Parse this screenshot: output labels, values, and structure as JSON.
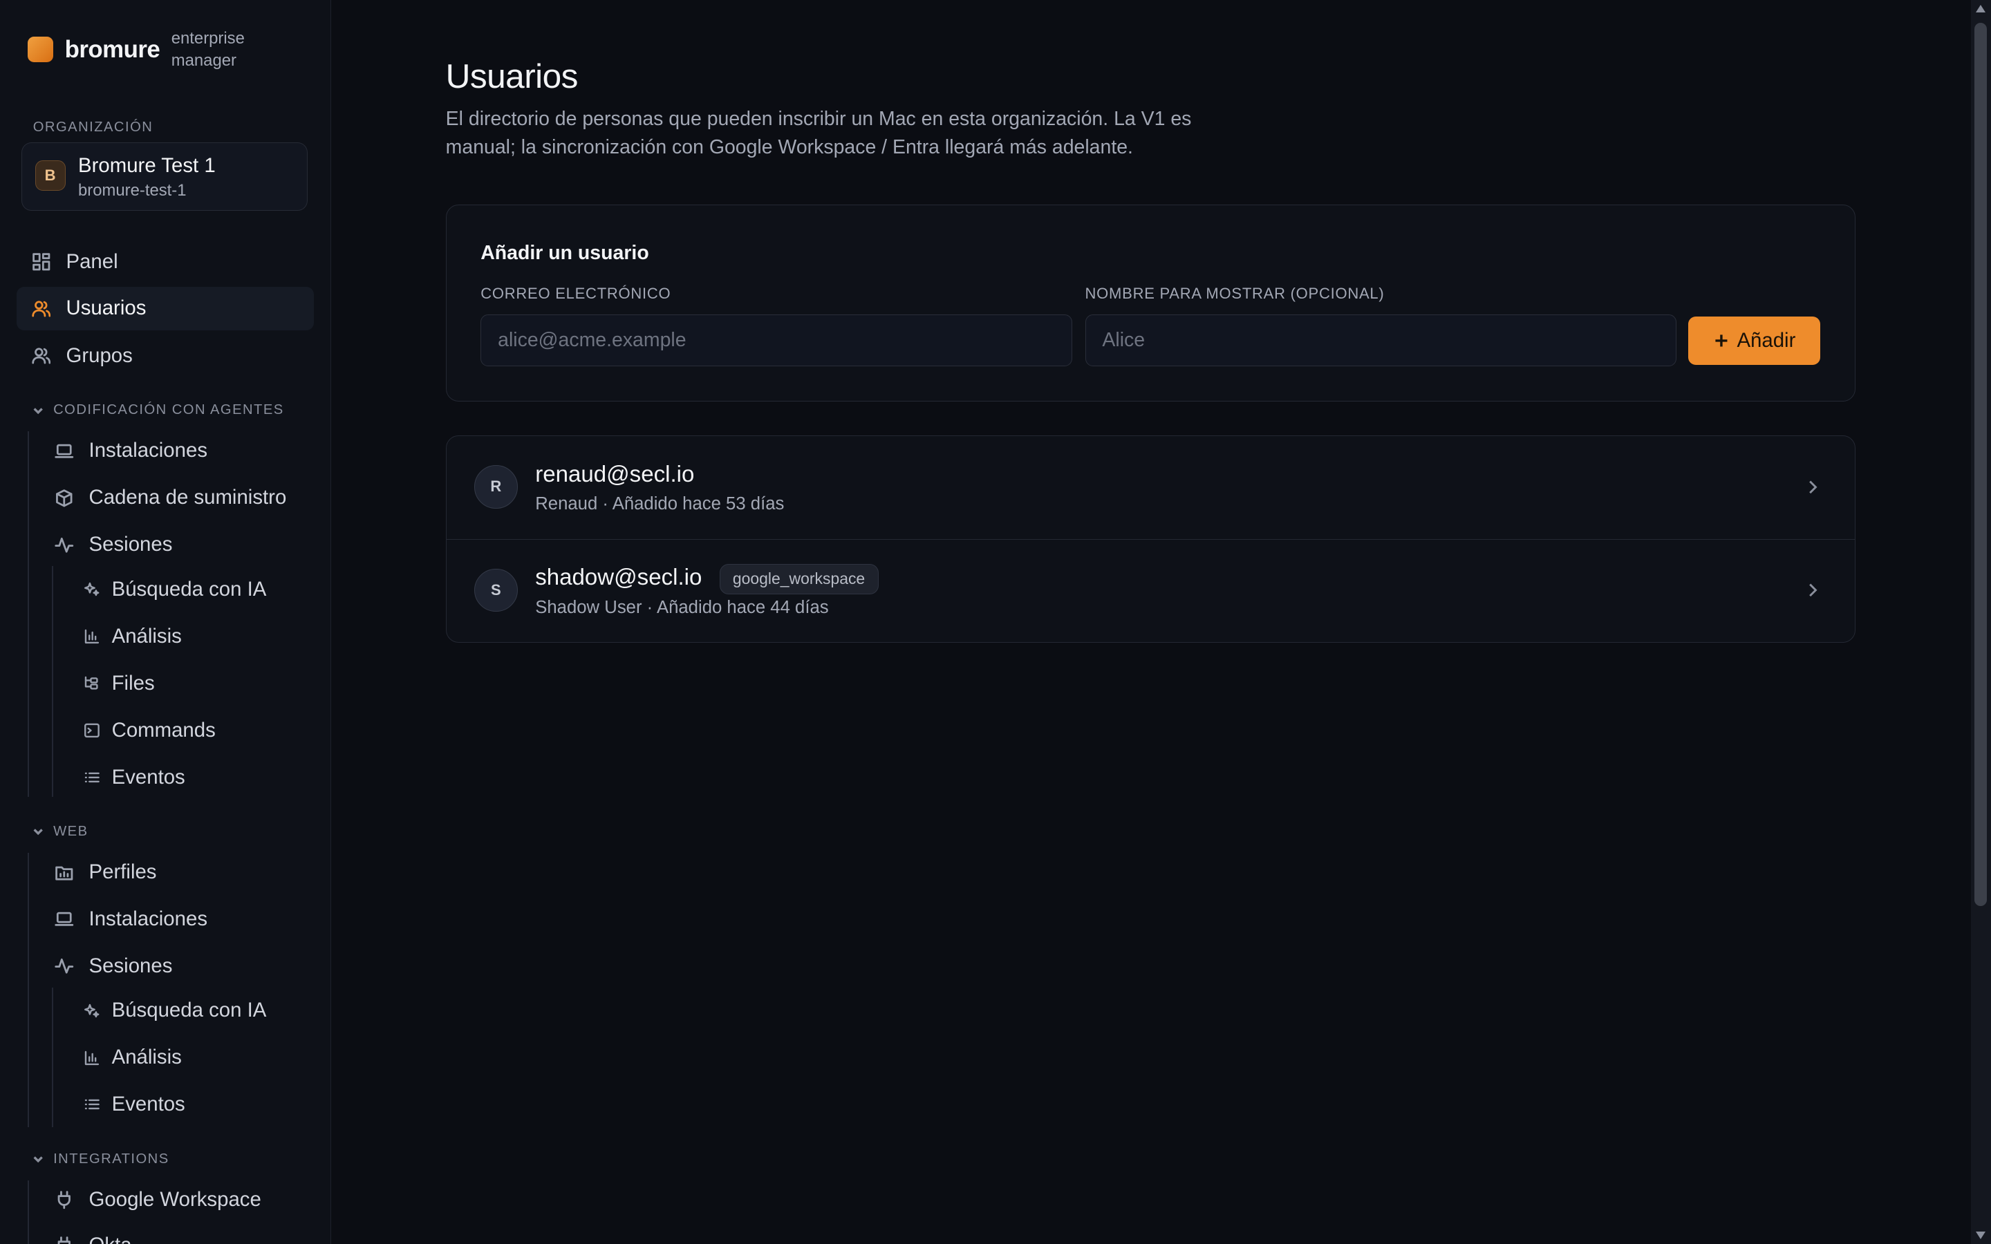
{
  "brand": {
    "name": "bromure",
    "subtitle": "enterprise manager"
  },
  "org": {
    "section_label": "ORGANIZACIÓN",
    "initial": "B",
    "name": "Bromure Test 1",
    "slug": "bromure-test-1"
  },
  "nav": {
    "panel": "Panel",
    "usuarios": "Usuarios",
    "grupos": "Grupos"
  },
  "coding": {
    "header": "CODIFICACIÓN CON AGENTES",
    "instalaciones": "Instalaciones",
    "cadena": "Cadena de suministro",
    "sesiones": "Sesiones",
    "busqueda": "Búsqueda con IA",
    "analisis": "Análisis",
    "files": "Files",
    "commands": "Commands",
    "eventos": "Eventos"
  },
  "web": {
    "header": "WEB",
    "perfiles": "Perfiles",
    "instalaciones": "Instalaciones",
    "sesiones": "Sesiones",
    "busqueda": "Búsqueda con IA",
    "analisis": "Análisis",
    "eventos": "Eventos"
  },
  "integrations": {
    "header": "INTEGRATIONS",
    "google": "Google Workspace",
    "next_partial": "Okta"
  },
  "page": {
    "title": "Usuarios",
    "description": "El directorio de personas que pueden inscribir un Mac en esta organización. La V1 es manual; la sincronización con Google Workspace / Entra llegará más adelante."
  },
  "add_user": {
    "title": "Añadir un usuario",
    "email_label": "CORREO ELECTRÓNICO",
    "email_placeholder": "alice@acme.example",
    "email_value": "",
    "name_label": "NOMBRE PARA MOSTRAR (OPCIONAL)",
    "name_placeholder": "Alice",
    "name_value": "",
    "button_label": "Añadir"
  },
  "users": [
    {
      "initial": "R",
      "email": "renaud@secl.io",
      "meta": "Renaud · Añadido hace 53 días",
      "badge": ""
    },
    {
      "initial": "S",
      "email": "shadow@secl.io",
      "meta": "Shadow User · Añadido hace 44 días",
      "badge": "google_workspace"
    }
  ],
  "colors": {
    "accent": "#ee8c2c",
    "background": "#0b0d13",
    "sidebar": "#0e1118"
  }
}
